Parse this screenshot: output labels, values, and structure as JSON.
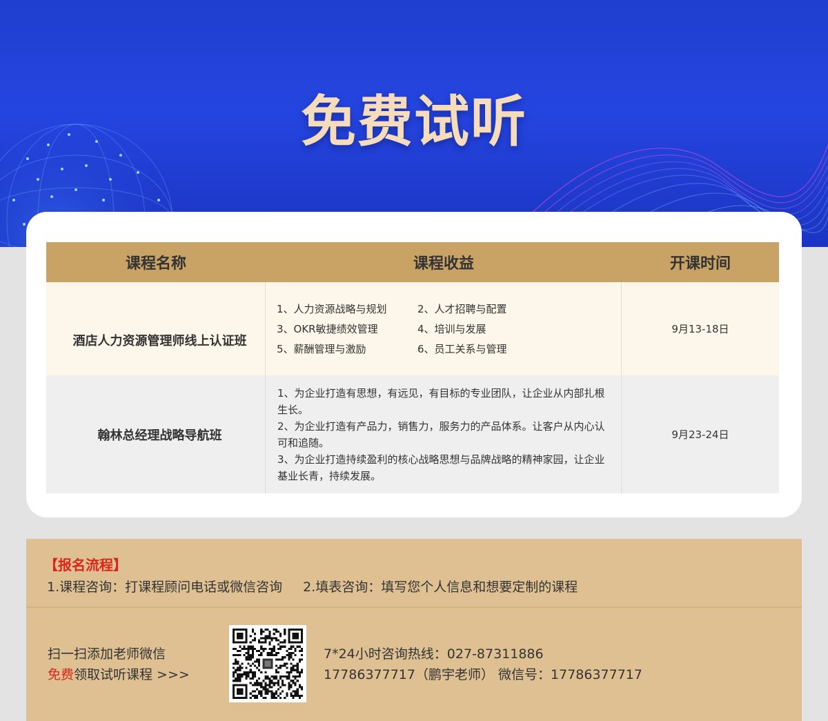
{
  "banner": {
    "title": "免费试听"
  },
  "table": {
    "headers": [
      "课程名称",
      "课程收益",
      "开课时间"
    ],
    "rows": [
      {
        "name": "酒店人力资源管理师线上认证班",
        "benefits": [
          "1、人力资源战略与规划",
          "2、人才招聘与配置",
          "3、OKR敏捷绩效管理",
          "4、培训与发展",
          "5、薪酬管理与激励",
          "6、员工关系与管理"
        ],
        "date": "9月13-18日"
      },
      {
        "name": "翰林总经理战略导航班",
        "benefits": [
          "1、为企业打造有思想，有远见，有目标的专业团队，让企业从内部扎根生长。",
          "2、为企业打造有产品力，销售力，服务力的产品体系。让客户从内心认可和追随。",
          "3、为企业打造持续盈利的核心战略思想与品牌战略的精神家园，让企业基业长青，持续发展。"
        ],
        "date": "9月23-24日"
      }
    ]
  },
  "registration": {
    "title": "【报名流程】",
    "step1": "1.课程咨询：打课程顾问电话或微信咨询",
    "step2": "2.填表咨询：填写您个人信息和想要定制的课程",
    "scan_line1": "扫一扫添加老师微信",
    "scan_line2_red": "免费",
    "scan_line2_rest": "领取试听课程 >>>",
    "hotline": "7*24小时咨询热线：027-87311886",
    "wechat": "17786377717（鹏宇老师） 微信号：17786377717"
  },
  "colors": {
    "banner_blue": "#2545e0",
    "title_gold": "#f7dcbc",
    "header_gold": "#c9a365",
    "reg_bg": "#dec092",
    "accent_red": "#d9271b"
  },
  "icons": {
    "qr": "qr-code-icon",
    "globe": "globe-decoration-icon",
    "waves": "wave-lines-decoration-icon"
  }
}
